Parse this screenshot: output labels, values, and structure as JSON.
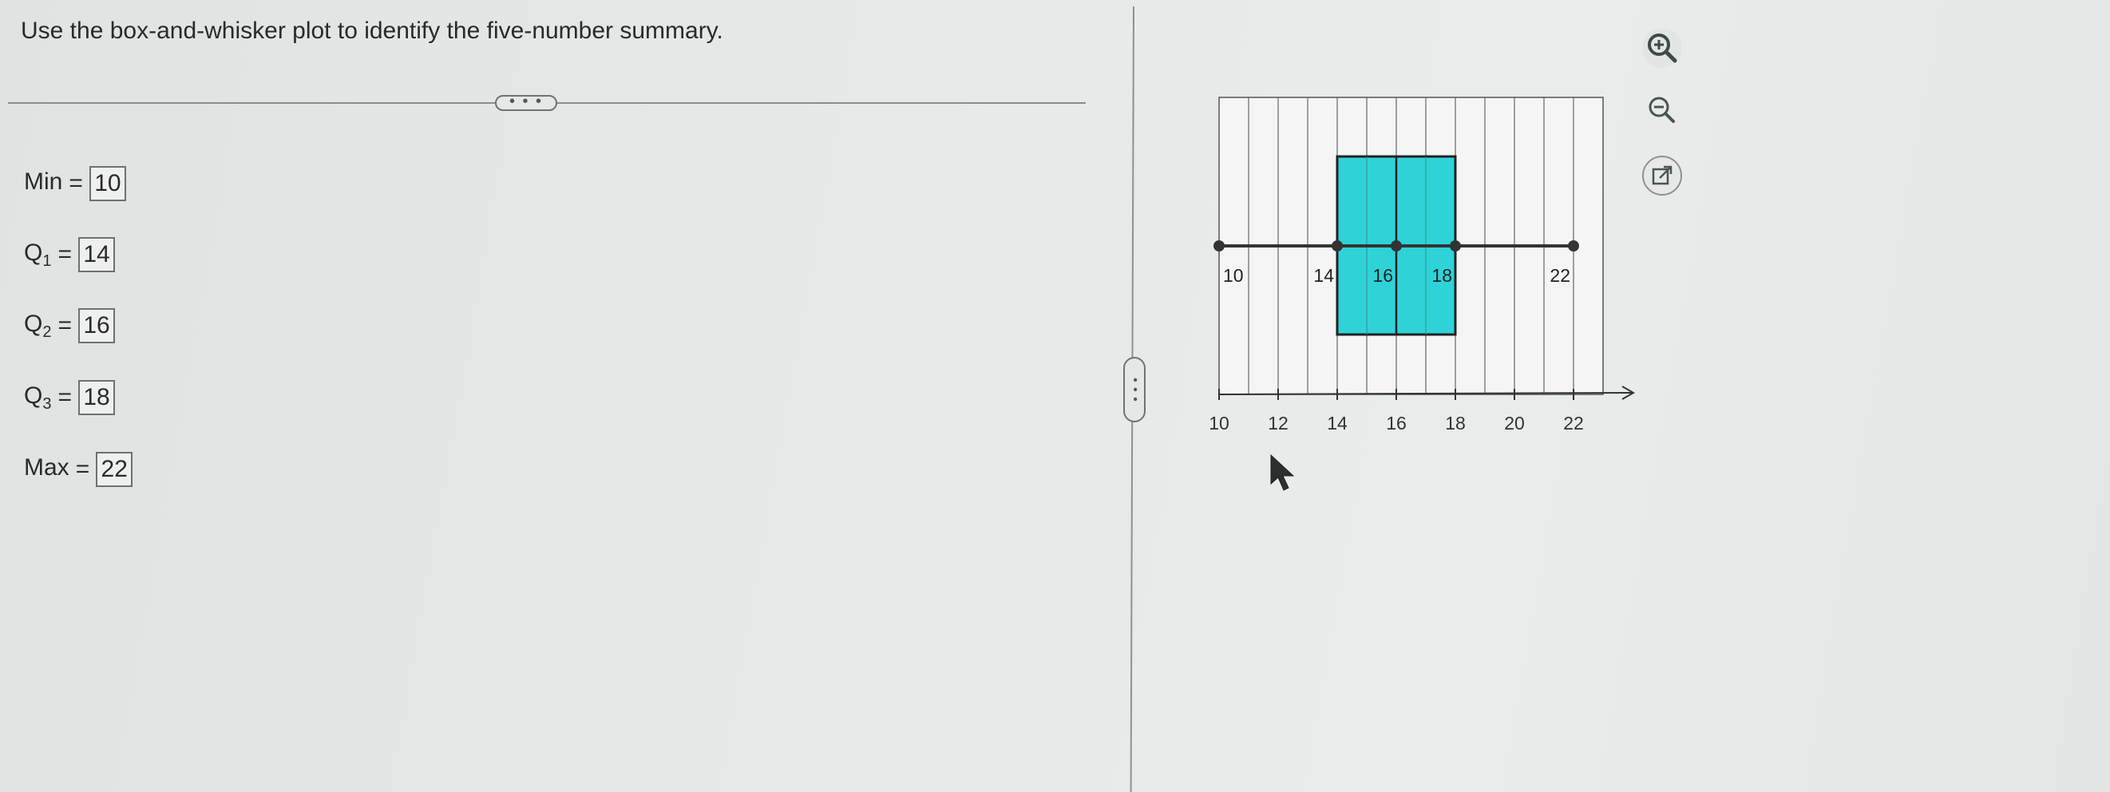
{
  "instruction": "Use the box-and-whisker plot to identify the five-number summary.",
  "more_button": "• • •",
  "toggle_button": "• • •",
  "answers": [
    {
      "label": "Min",
      "sub": "",
      "value": "10"
    },
    {
      "label": "Q",
      "sub": "1",
      "value": "14"
    },
    {
      "label": "Q",
      "sub": "2",
      "value": "16"
    },
    {
      "label": "Q",
      "sub": "3",
      "value": "18"
    },
    {
      "label": "Max",
      "sub": "",
      "value": "22"
    }
  ],
  "equals": "=",
  "chart_data": {
    "type": "boxplot",
    "min": 10,
    "q1": 14,
    "median": 16,
    "q3": 18,
    "max": 22,
    "xlim": [
      10,
      23
    ],
    "ticks": [
      10,
      12,
      14,
      16,
      18,
      20,
      22
    ],
    "tick_labels": [
      "10",
      "12",
      "14",
      "16",
      "18",
      "20",
      "22"
    ],
    "point_labels": [
      "10",
      "14",
      "16",
      "18",
      "22"
    ],
    "grid": true,
    "box_color": "#2ed3d8"
  },
  "icons": {
    "zoom_in": "zoom-in-icon",
    "zoom_out": "zoom-out-icon",
    "external": "external-link-icon",
    "cursor": "mouse-cursor-icon"
  }
}
